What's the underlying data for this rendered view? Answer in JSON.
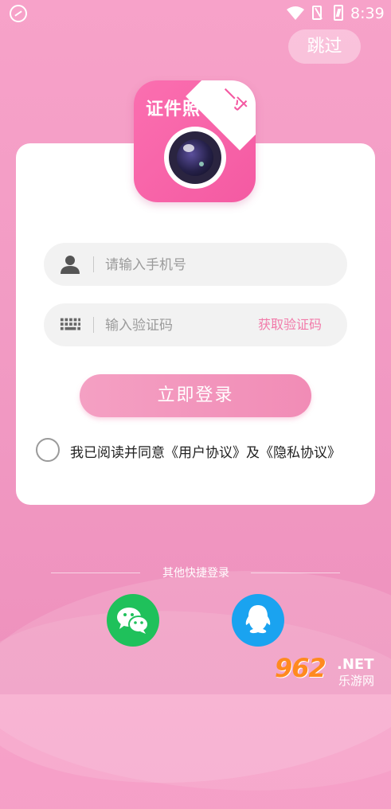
{
  "status_bar": {
    "time": "8:39"
  },
  "header": {
    "skip_label": "跳过"
  },
  "logo": {
    "title": "证件照",
    "corner_text": "一寸"
  },
  "form": {
    "phone_placeholder": "请输入手机号",
    "code_placeholder": "输入验证码",
    "get_code_label": "获取验证码",
    "login_label": "立即登录",
    "agreement_text": "我已阅读并同意《用户协议》及《隐私协议》",
    "agreement_checked": false
  },
  "other_login": {
    "title": "其他快捷登录",
    "options": [
      {
        "icon": "wechat-icon",
        "color": "#1fc15b"
      },
      {
        "icon": "qq-icon",
        "color": "#1aa3f0"
      }
    ]
  },
  "watermark": {
    "logo": "962",
    "suffix": ".NET",
    "sub": "乐游网"
  },
  "colors": {
    "accent": "#f27aa9",
    "button": "#f18cb6",
    "background": "#f29bc4"
  }
}
